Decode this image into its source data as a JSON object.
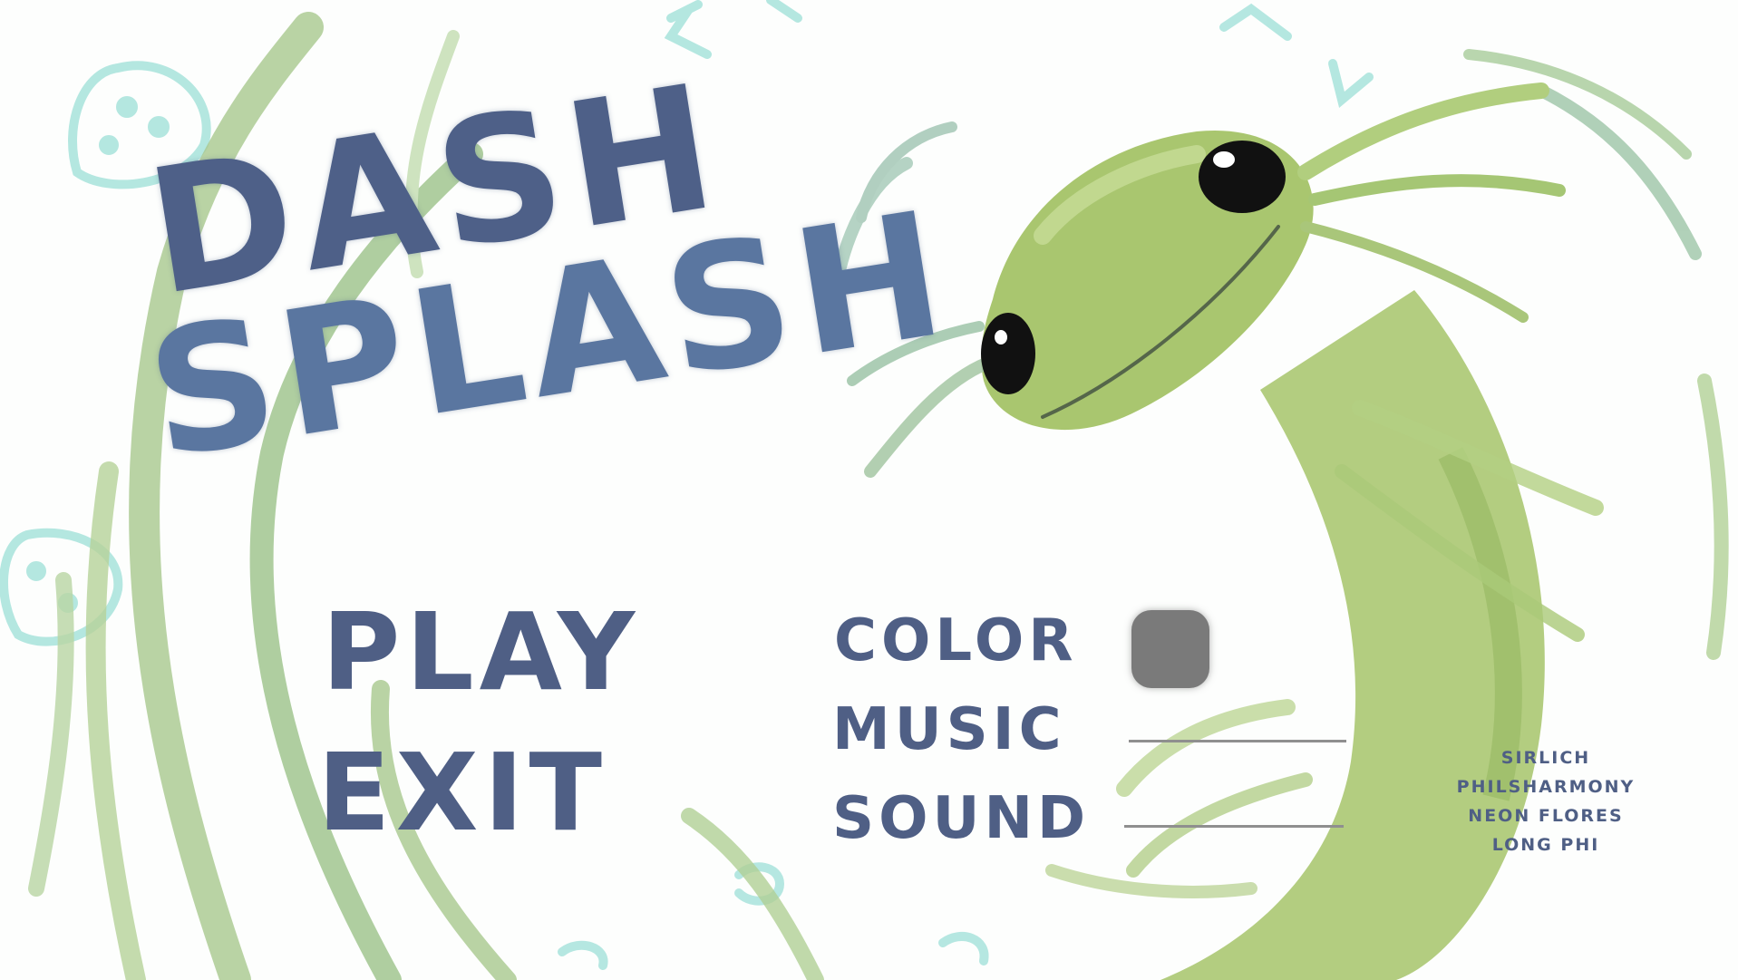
{
  "game": {
    "title_line_1": "DASH",
    "title_line_2": "SPLASH"
  },
  "menu": {
    "play_label": "PLAY",
    "exit_label": "EXIT"
  },
  "options": {
    "color_label": "COLOR",
    "music_label": "MUSIC",
    "sound_label": "SOUND",
    "color_swatch_value": "#7a7a7a"
  },
  "credits": [
    "SIRLICH",
    "PHILSHARMONY",
    "NEON FLORES",
    "LONG PHI"
  ],
  "palette": {
    "text": "#4f5f85",
    "title": "#4e6088",
    "creature": "#a6c46a",
    "seaweed": "#9fc389",
    "bubbles": "#a8e3dc"
  }
}
